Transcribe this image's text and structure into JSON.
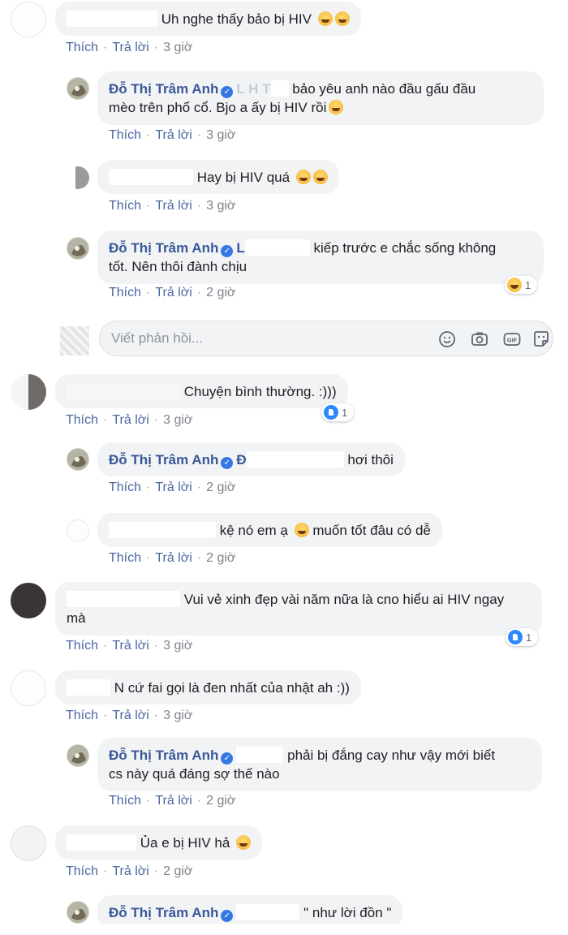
{
  "actions": {
    "like": "Thích",
    "reply": "Trả lời",
    "separator": "·"
  },
  "composer": {
    "placeholder": "Viết phản hồi...",
    "tools": [
      "smile-icon",
      "camera-icon",
      "gif-icon",
      "sticker-icon"
    ]
  },
  "comments": [
    {
      "id": "c1",
      "text": "Uh nghe thấy bảo bị HIV",
      "time": "3 giờ"
    },
    {
      "id": "r1",
      "name": "Đỗ Thị Trâm Anh",
      "mention": "L  H  T",
      "text_line1": "bảo yêu anh nào đầu gấu đầu",
      "text_line2": "mèo trên phố cổ. Bjo a ấy bị HIV rồi",
      "time": "3 giờ"
    },
    {
      "id": "r2",
      "text": "Hay bị HIV quá",
      "time": "3 giờ"
    },
    {
      "id": "r3",
      "name": "Đỗ Thị Trâm Anh",
      "mention": "L",
      "text_line1": "kiếp trước e chắc sống không",
      "text_line2": "tốt. Nên thôi đành chịu",
      "time": "2 giờ",
      "reaction_count": "1"
    },
    {
      "id": "c2",
      "text": "Chuyện bình thường. :)))",
      "time": "3 giờ",
      "reaction_count": "1"
    },
    {
      "id": "r4",
      "name": "Đỗ Thị Trâm Anh",
      "mention": "Đ",
      "text": "hơi thôi",
      "time": "2 giờ"
    },
    {
      "id": "r5",
      "text": "kệ nó em ạ",
      "text_after": "muốn tốt đâu có dễ",
      "time": "2 giờ"
    },
    {
      "id": "c3",
      "text_line1": "Vui vẻ xinh đẹp vài năm nữa là cno hiểu ai HIV ngay",
      "text_line2": "mà",
      "time": "3 giờ",
      "reaction_count": "1"
    },
    {
      "id": "c4",
      "text": "N cứ fai gọi là đen nhất của nhật ah :))",
      "time": "3 giờ"
    },
    {
      "id": "r6",
      "name": "Đỗ Thị Trâm Anh",
      "text_line1": "phải bị đắng cay như vậy mới biết",
      "text_line2": "cs này quá đáng sợ thế nào",
      "time": "2 giờ"
    },
    {
      "id": "c5",
      "text": "Ủa e bị HIV hả",
      "time": "2 giờ"
    },
    {
      "id": "r7",
      "name": "Đỗ Thị Trâm Anh",
      "text": "\" như lời đồn \""
    }
  ],
  "colors": {
    "bubble": "#f2f3f5",
    "name": "#385898",
    "action": "#4b67a1",
    "meta": "#858a93",
    "verified": "#3578e5",
    "like_reaction": "#2d88ff"
  }
}
